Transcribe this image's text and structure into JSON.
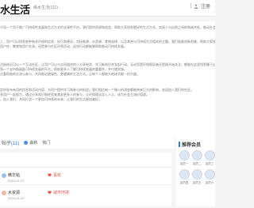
{
  "header": {
    "logo_text": "水生活",
    "logo_subtitle": "缘水生活(111)",
    "login_label": "注册",
    "login_icon": "user-icon"
  },
  "intro": {
    "para1": "介绍一个用于推广可持续性发展和生活方式的全球性平台。我们提供资源和机会，帮助大家找到更好的生活方式，实现人与自然之间的和谐共处，推动社会整体进步与发展。",
    "para2a": "上，用户可以找到各种有关环保的信息、技巧和建议，包括能源、水资源、食物选择，以及其他与可持续生活相关的主题。我们鼓励创新思维，帮助大家找到更适合自己的方式。",
    "para2b": "用户在，教育和用户交流，还是参与社区环保活动，这些行动都能够帮助推动可持续发展。",
    "para3a": "注册成员可以一个互动社区，让用户可以与志同道合的人分享经验、学习新知识并发起行动，无论您是环保倡导者还是刚开始关注，都能在这里找到属于自己的位置。",
    "para3b": "到一个支持和鼓励可持续发展的平台，帮助更多人了解可持续发展的重要性，并付诸实践。",
    "para3c": "注重积极的交流与参与，共同推动更绿色、更健康的生活方式，让每个人都能为地球贡献一份力量。",
    "para4a": "定时发布有用的信息和活动内容，为用户提供学习和参与的机会。我们相信每一个微小的改变都能带来巨大的影响，欢迎加入我们的社区。",
    "para4b": "多用户一起努力，通过分享知识和经验来激发更多人的参与，让环保理念深入人心，成为社会主流价值观。",
    "para4c": "，加入我们，共同打造一个更加可持续的未来，让我们的生活更加美好。"
  },
  "meta": {
    "count_label": "帖子",
    "count_value": "(11)",
    "tag1": "最新",
    "tag2": "热门"
  },
  "posts": [
    {
      "title": "精华帖",
      "sub": "2024-01-01",
      "tag": "喜欢"
    },
    {
      "title": "水资源",
      "sub": "2024-01-02",
      "tag": "城市环境"
    }
  ],
  "sidebar": {
    "title": "推荐会员",
    "members": [
      {
        "name": "会员一"
      },
      {
        "name": "会员二"
      },
      {
        "name": "会员三"
      },
      {
        "name": "会员四"
      },
      {
        "name": "会员五"
      },
      {
        "name": "会员六"
      }
    ]
  },
  "colors": {
    "accent": "#3478f6",
    "heart": "#e0524b"
  }
}
